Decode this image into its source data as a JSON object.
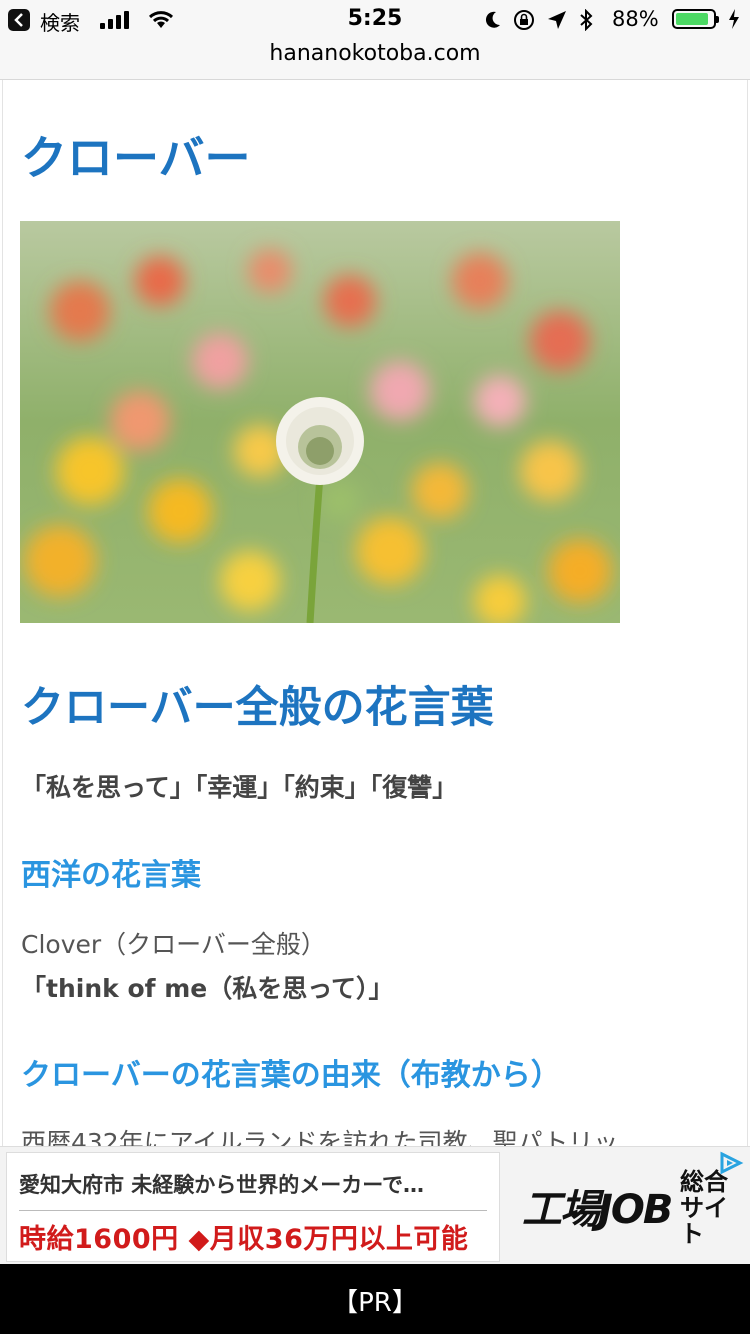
{
  "status_bar": {
    "back_label": "検索",
    "time": "5:25",
    "battery_percent": "88%",
    "battery_level": 0.88
  },
  "browser": {
    "url": "hananokotoba.com"
  },
  "article": {
    "title": "クローバー",
    "image_icon": "clover-flower-photo",
    "section_general": {
      "heading": "クローバー全般の花言葉",
      "meanings": "「私を思って」「幸運」「約束」「復讐」"
    },
    "section_western": {
      "heading": "西洋の花言葉",
      "name": "Clover（クローバー全般）",
      "meaning": "「think of me（私を思って）」"
    },
    "section_origin": {
      "heading": "クローバーの花言葉の由来（布教から）",
      "paragraph": "西暦432年にアイルランドを訪れた司教、聖パトリッ"
    }
  },
  "ad": {
    "line1": "愛知大府市 未経験から世界的メーカーで…",
    "line2": "時給1600円 ◆月収36万円以上可能",
    "logo_main": "工場JOB",
    "logo_sub": "総合サイト"
  },
  "bottom_bar": {
    "label": "【PR】"
  },
  "colors": {
    "heading_primary": "#1d74c0",
    "heading_secondary": "#2a95e0",
    "ad_price": "#d11b1b"
  }
}
